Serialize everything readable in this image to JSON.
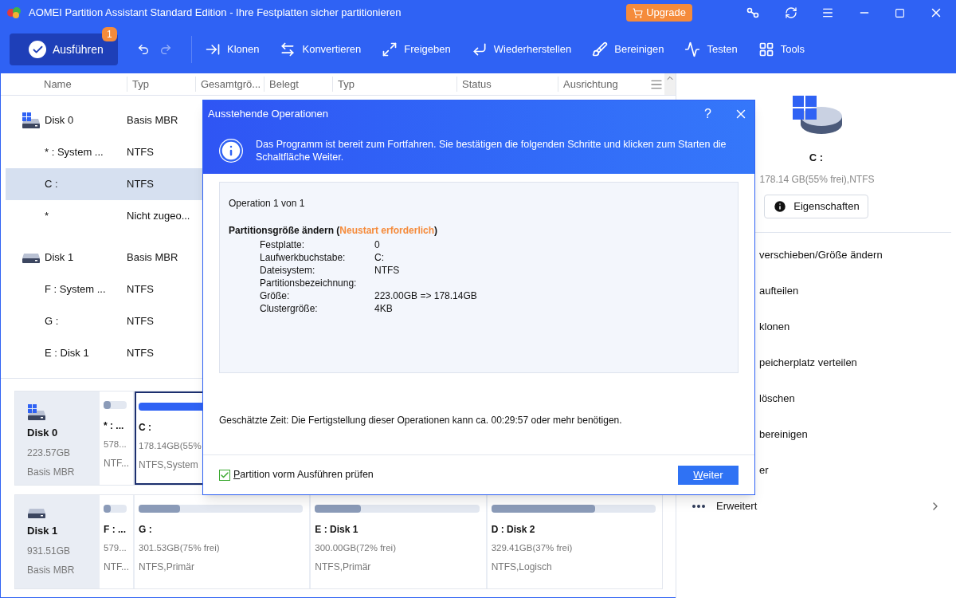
{
  "window": {
    "title": "AOMEI Partition Assistant Standard Edition - Ihre Festplatten sicher partitionieren",
    "upgrade": "Upgrade"
  },
  "toolbar": {
    "execute": {
      "label": "Ausführen",
      "badge": "1"
    },
    "items": [
      {
        "label": "Klonen"
      },
      {
        "label": "Konvertieren"
      },
      {
        "label": "Freigeben"
      },
      {
        "label": "Wiederherstellen"
      },
      {
        "label": "Bereinigen"
      },
      {
        "label": "Testen"
      },
      {
        "label": "Tools"
      }
    ]
  },
  "table": {
    "columns": [
      "Name",
      "Typ",
      "Gesamtgrö...",
      "Belegt",
      "Typ",
      "Status",
      "Ausrichtung"
    ],
    "rows": [
      {
        "kind": "system-disk",
        "name": "Disk 0",
        "type": "Basis MBR",
        "selected": false
      },
      {
        "kind": "partition",
        "name": "* : System ...",
        "type": "NTFS",
        "selected": false
      },
      {
        "kind": "partition",
        "name": "C :",
        "type": "NTFS",
        "selected": true
      },
      {
        "kind": "partition",
        "name": "*",
        "type": "Nicht zugeo...",
        "selected": false
      },
      {
        "kind": "disk",
        "name": "Disk 1",
        "type": "Basis MBR",
        "selected": false
      },
      {
        "kind": "partition",
        "name": "F : System ...",
        "type": "NTFS",
        "selected": false
      },
      {
        "kind": "partition",
        "name": "G :",
        "type": "NTFS",
        "selected": false
      },
      {
        "kind": "partition",
        "name": "E : Disk 1",
        "type": "NTFS",
        "selected": false
      }
    ]
  },
  "disk_map": [
    {
      "kind": "system-disk",
      "name": "Disk 0",
      "size": "223.57GB",
      "type": "Basis MBR",
      "partitions": [
        {
          "name": "* : ...",
          "size": "578...",
          "fs": "NTF...",
          "level": 0.3,
          "selected": false,
          "wide": false
        },
        {
          "name": "C :",
          "size": "178.14GB(55%",
          "fs": "NTFS,System",
          "level": 0.45,
          "selected": true,
          "wide": true
        }
      ]
    },
    {
      "kind": "disk",
      "name": "Disk 1",
      "size": "931.51GB",
      "type": "Basis MBR",
      "partitions": [
        {
          "name": "F : ...",
          "size": "579...",
          "fs": "NTF...",
          "level": 0.3,
          "selected": false,
          "wide": false
        },
        {
          "name": "G :",
          "size": "301.53GB(75% frei)",
          "fs": "NTFS,Primär",
          "level": 0.25,
          "selected": false,
          "wide": true
        },
        {
          "name": "E : Disk 1",
          "size": "300.00GB(72% frei)",
          "fs": "NTFS,Primär",
          "level": 0.28,
          "selected": false,
          "wide": true
        },
        {
          "name": "D : Disk 2",
          "size": "329.41GB(37% frei)",
          "fs": "NTFS,Logisch",
          "level": 0.63,
          "selected": false,
          "wide": true
        }
      ]
    }
  ],
  "side_panel": {
    "name": "C :",
    "detail": "178.14 GB(55% frei),NTFS",
    "properties": "Eigenschaften",
    "actions": [
      {
        "kind": "action",
        "label": "verschieben/Größe ändern"
      },
      {
        "kind": "action",
        "label": "aufteilen"
      },
      {
        "kind": "action",
        "label": "klonen"
      },
      {
        "kind": "action",
        "label": "peicherplatz verteilen"
      },
      {
        "kind": "action",
        "label": "löschen"
      },
      {
        "kind": "action",
        "label": "bereinigen"
      },
      {
        "kind": "action",
        "label": "er"
      },
      {
        "kind": "submenu",
        "label": "Erweitert"
      }
    ]
  },
  "dialog": {
    "title": "Ausstehende Operationen",
    "help": "?",
    "info": "Das Programm ist bereit zum Fortfahren. Sie bestätigen die folgenden Schritte und klicken zum Starten die Schaltfläche Weiter.",
    "counter": "Operation 1 von 1",
    "op_title": "Partitionsgröße ändern (",
    "op_note": "Neustart erforderlich",
    "op_title_end": ")",
    "details": [
      {
        "label": "Festplatte:",
        "value": "0"
      },
      {
        "label": "Laufwerkbuchstabe:",
        "value": "C:"
      },
      {
        "label": "Dateisystem:",
        "value": "NTFS"
      },
      {
        "label": "Partitionsbezeichnung:"
      },
      {
        "label": "Größe:",
        "value": "223.00GB => 178.14GB"
      },
      {
        "label": "Clustergröße:",
        "value": "4KB"
      }
    ],
    "estimate": "Geschätzte Zeit: Die Fertigstellung dieser Operationen kann ca. 00:29:57 oder mehr benötigen.",
    "check": {
      "label": "Partition vorm Ausführen prüfen",
      "checked": true
    },
    "button": "Weiter"
  }
}
